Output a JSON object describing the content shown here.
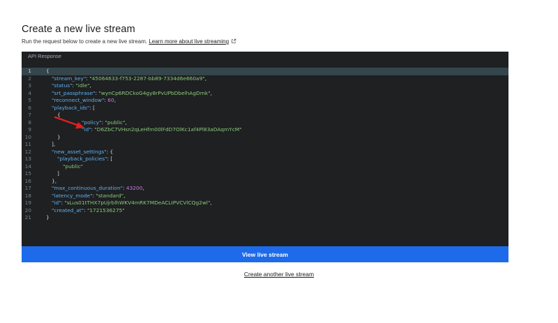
{
  "page": {
    "title": "Create a new live stream",
    "subtitle": "Run the request below to create a new live stream.",
    "learn_link": "Learn more about live streaming",
    "external_icon": "external-link-icon"
  },
  "panel": {
    "header": "API Response",
    "arrow_icon": "red-arrow-annotation"
  },
  "code_lines": [
    {
      "n": "1",
      "text": "{"
    },
    {
      "n": "2",
      "text": "\"stream_key\": \"45064633-f753-2287-bb89-7334d6e660a9\","
    },
    {
      "n": "3",
      "text": "\"status\": \"idle\","
    },
    {
      "n": "4",
      "text": "\"srt_passphrase\": \"wynCp6RDCkoG4gy8rPvUPbDbelhAgDmk\","
    },
    {
      "n": "5",
      "text": "\"reconnect_window\": 60,"
    },
    {
      "n": "6",
      "text": "\"playback_ids\": ["
    },
    {
      "n": "7",
      "text": "{"
    },
    {
      "n": "8",
      "text": "\"policy\": \"public\","
    },
    {
      "n": "9",
      "text": "\"id\": \"D6ZbC7VHsn2qLeHfm00lFdD7OlKc1af4Pl83aDAqmYcM\""
    },
    {
      "n": "10",
      "text": "}"
    },
    {
      "n": "11",
      "text": "],"
    },
    {
      "n": "12",
      "text": "\"new_asset_settings\": {"
    },
    {
      "n": "13",
      "text": "\"playback_policies\": ["
    },
    {
      "n": "14",
      "text": "\"public\""
    },
    {
      "n": "15",
      "text": "]"
    },
    {
      "n": "16",
      "text": "},"
    },
    {
      "n": "17",
      "text": "\"max_continuous_duration\": 43200,"
    },
    {
      "n": "18",
      "text": "\"latency_mode\": \"standard\","
    },
    {
      "n": "19",
      "text": "\"id\": \"sLus01tTHX7pUjrblhWKV4mRK7MDeACLIPVCVlCQg2wl\","
    },
    {
      "n": "20",
      "text": "\"created_at\": \"1721536275\""
    },
    {
      "n": "21",
      "text": "}"
    }
  ],
  "buttons": {
    "view": "View live stream",
    "another": "Create another live stream"
  },
  "colors": {
    "panel_bg": "#1e2022",
    "active_line": "#35454c",
    "key": "#5fb0f0",
    "string": "#8cc87a",
    "number": "#c97ae0",
    "button": "#1d6bea",
    "arrow": "#e02020"
  }
}
